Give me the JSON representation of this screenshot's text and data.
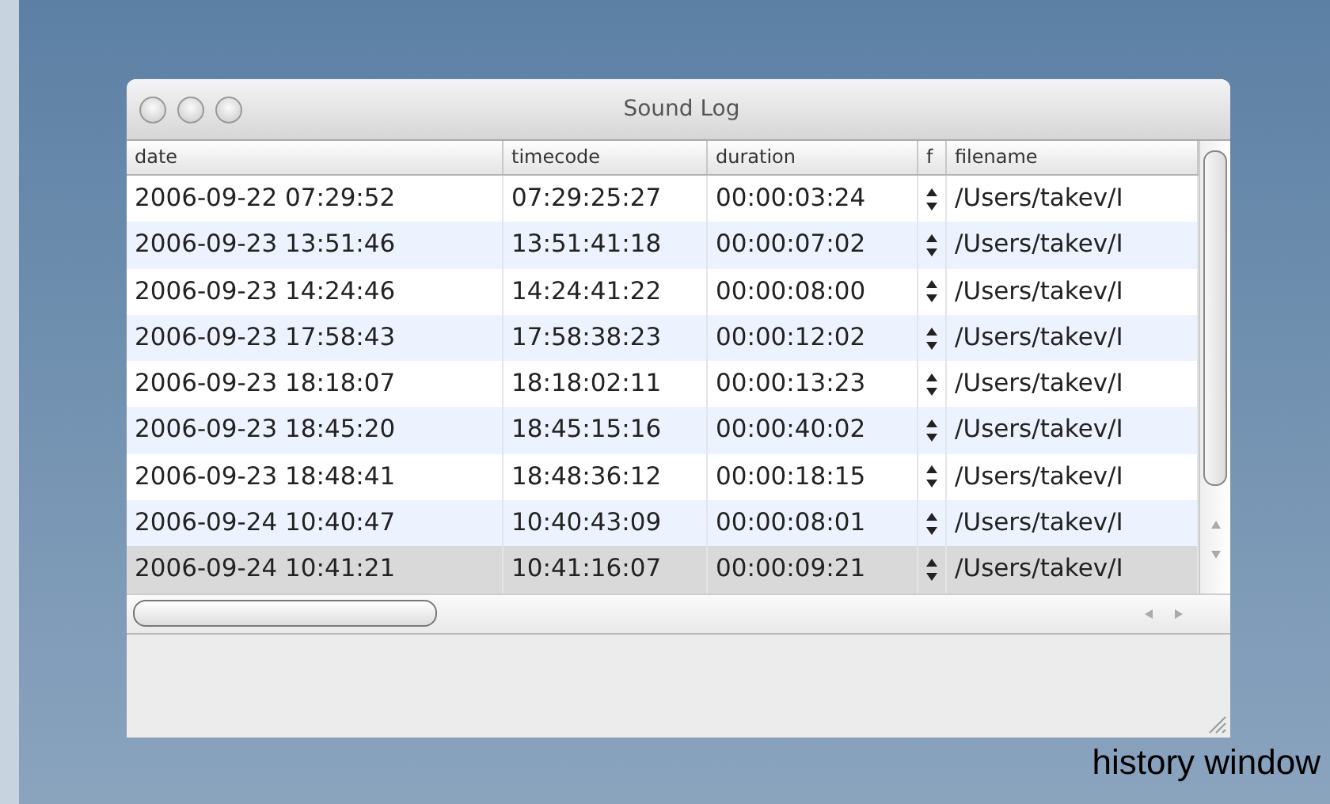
{
  "window": {
    "title": "Sound Log"
  },
  "table": {
    "columns": [
      "date",
      "timecode",
      "duration",
      "f",
      "filename"
    ],
    "rows": [
      {
        "date": "2006-09-22 07:29:52",
        "timecode": "07:29:25:27",
        "duration": "00:00:03:24",
        "filename": "/Users/takev/I",
        "selected": false
      },
      {
        "date": "2006-09-23 13:51:46",
        "timecode": "13:51:41:18",
        "duration": "00:00:07:02",
        "filename": "/Users/takev/I",
        "selected": false
      },
      {
        "date": "2006-09-23 14:24:46",
        "timecode": "14:24:41:22",
        "duration": "00:00:08:00",
        "filename": "/Users/takev/I",
        "selected": false
      },
      {
        "date": "2006-09-23 17:58:43",
        "timecode": "17:58:38:23",
        "duration": "00:00:12:02",
        "filename": "/Users/takev/I",
        "selected": false
      },
      {
        "date": "2006-09-23 18:18:07",
        "timecode": "18:18:02:11",
        "duration": "00:00:13:23",
        "filename": "/Users/takev/I",
        "selected": false
      },
      {
        "date": "2006-09-23 18:45:20",
        "timecode": "18:45:15:16",
        "duration": "00:00:40:02",
        "filename": "/Users/takev/I",
        "selected": false
      },
      {
        "date": "2006-09-23 18:48:41",
        "timecode": "18:48:36:12",
        "duration": "00:00:18:15",
        "filename": "/Users/takev/I",
        "selected": false
      },
      {
        "date": "2006-09-24 10:40:47",
        "timecode": "10:40:43:09",
        "duration": "00:00:08:01",
        "filename": "/Users/takev/I",
        "selected": false
      },
      {
        "date": "2006-09-24 10:41:21",
        "timecode": "10:41:16:07",
        "duration": "00:00:09:21",
        "filename": "/Users/takev/I",
        "selected": true
      }
    ]
  },
  "caption": "history window"
}
